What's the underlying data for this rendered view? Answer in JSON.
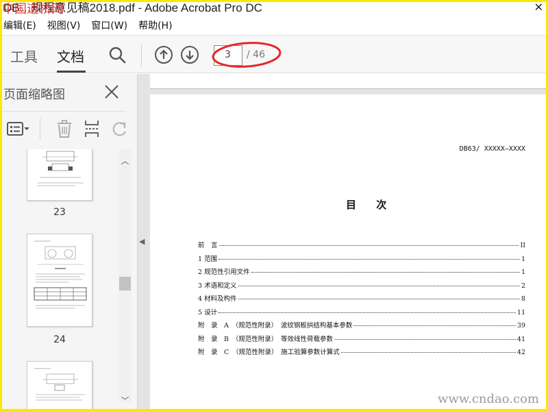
{
  "window": {
    "title": "DB…规程意见稿2018.pdf - Adobe Acrobat Pro DC",
    "close_glyph": "✕",
    "watermark": "中国道桥网"
  },
  "menubar": {
    "items": [
      {
        "label": "编辑(E)"
      },
      {
        "label": "视图(V)"
      },
      {
        "label": "窗口(W)"
      },
      {
        "label": "帮助(H)"
      }
    ]
  },
  "toolbar": {
    "tab_tools": "工具",
    "tab_document": "文档",
    "current_page": "3",
    "total_pages": "/ 46",
    "highlight_color": "#e8262b"
  },
  "left_panel": {
    "title": "页面缩略图",
    "thumbnails": [
      {
        "label": "23"
      },
      {
        "label": "24"
      }
    ]
  },
  "document": {
    "code": "DB63/ XXXXX—XXXX",
    "heading": "目 次",
    "toc": [
      {
        "title": "前　言",
        "page": "II"
      },
      {
        "title": "1 范围",
        "page": "1"
      },
      {
        "title": "2 规范性引用文件",
        "page": "1"
      },
      {
        "title": "3 术语和定义",
        "page": "2"
      },
      {
        "title": "4 材料及构件",
        "page": "8"
      },
      {
        "title": "5 设计",
        "page": "11"
      },
      {
        "title": "附　录　A　（规范性附录）　波纹钢板拱结构基本参数",
        "page": "39"
      },
      {
        "title": "附　录　B　（规范性附录）　等效线性荷载参数",
        "page": "41"
      },
      {
        "title": "附　录　C　（规范性附录）　施工验算参数计算式",
        "page": "42"
      }
    ]
  },
  "site_watermark": "www.cndao.com"
}
